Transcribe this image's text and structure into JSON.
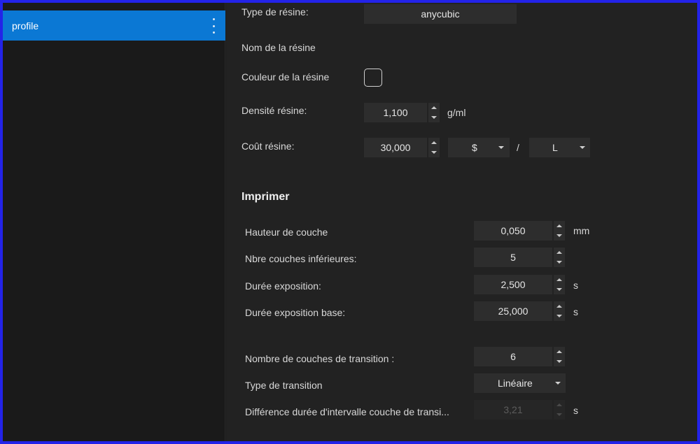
{
  "sidebar": {
    "profile_label": "profile"
  },
  "resin": {
    "type_label": "Type de résine:",
    "type_value": "anycubic",
    "name_label": "Nom de la résine",
    "color_label": "Couleur de la résine",
    "density_label": "Densité résine:",
    "density_value": "1,100",
    "density_unit": "g/ml",
    "cost_label": "Coût résine:",
    "cost_value": "30,000",
    "currency": "$",
    "separator": "/",
    "volume_unit": "L"
  },
  "print": {
    "heading": "Imprimer",
    "layer_height_label": "Hauteur de couche",
    "layer_height_value": "0,050",
    "layer_height_unit": "mm",
    "bottom_layers_label": "Nbre couches inférieures:",
    "bottom_layers_value": "5",
    "exposure_label": "Durée exposition:",
    "exposure_value": "2,500",
    "exposure_unit": "s",
    "base_exposure_label": "Durée exposition base:",
    "base_exposure_value": "25,000",
    "base_exposure_unit": "s",
    "transition_layers_label": "Nombre de couches de transition :",
    "transition_layers_value": "6",
    "transition_type_label": "Type de transition",
    "transition_type_value": "Linéaire",
    "interval_diff_label": "Différence durée d'intervalle couche de transi...",
    "interval_diff_value": "3,21",
    "interval_diff_unit": "s"
  }
}
